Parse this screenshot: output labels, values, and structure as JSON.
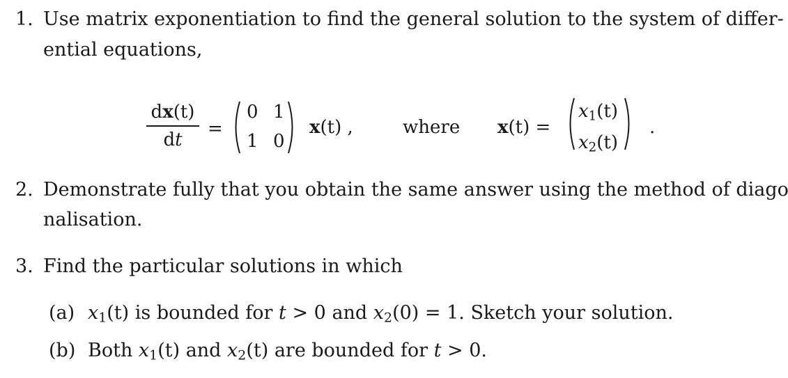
{
  "items": [
    {
      "number": "1.",
      "line1": "Use matrix exponentiation to find the general solution to the system of differ-",
      "line2": "ential equations,"
    },
    {
      "number": "2.",
      "line1": "Demonstrate fully that you obtain the same answer using the method of diago-",
      "line2": "nalisation."
    },
    {
      "number": "3.",
      "line1": "Find the particular solutions in which",
      "subitems": [
        {
          "label": "(a)",
          "pre": "",
          "var1": "x",
          "sub1": "1",
          "arg1": "(t)",
          "text1": " is bounded for ",
          "cond_var": "t",
          "cond_rel": " > 0 and ",
          "var2": "x",
          "sub2": "2",
          "arg2": "(0) = 1. Sketch your solution."
        },
        {
          "label": "(b)",
          "pre": "Both ",
          "var1": "x",
          "sub1": "1",
          "arg1": "(t)",
          "mid": " and ",
          "var2": "x",
          "sub2": "2",
          "arg2": "(t)",
          "text2": " are bounded for ",
          "cond_var": "t",
          "cond_rel": " > 0."
        }
      ]
    }
  ],
  "equation": {
    "frac_num_bold": "x",
    "frac_num_pre": "d",
    "frac_num_post": "(t)",
    "frac_den_pre": "d",
    "frac_den_var": "t",
    "equals": "=",
    "matrix": [
      [
        "0",
        "1"
      ],
      [
        "1",
        "0"
      ]
    ],
    "vector_bold": "x",
    "vector_arg": "(t) ,",
    "where": "where",
    "def_bold": "x",
    "def_arg": "(t) =",
    "components": [
      {
        "var": "x",
        "sub": "1",
        "arg": "(t)"
      },
      {
        "var": "x",
        "sub": "2",
        "arg": "(t)"
      }
    ],
    "end": "."
  }
}
